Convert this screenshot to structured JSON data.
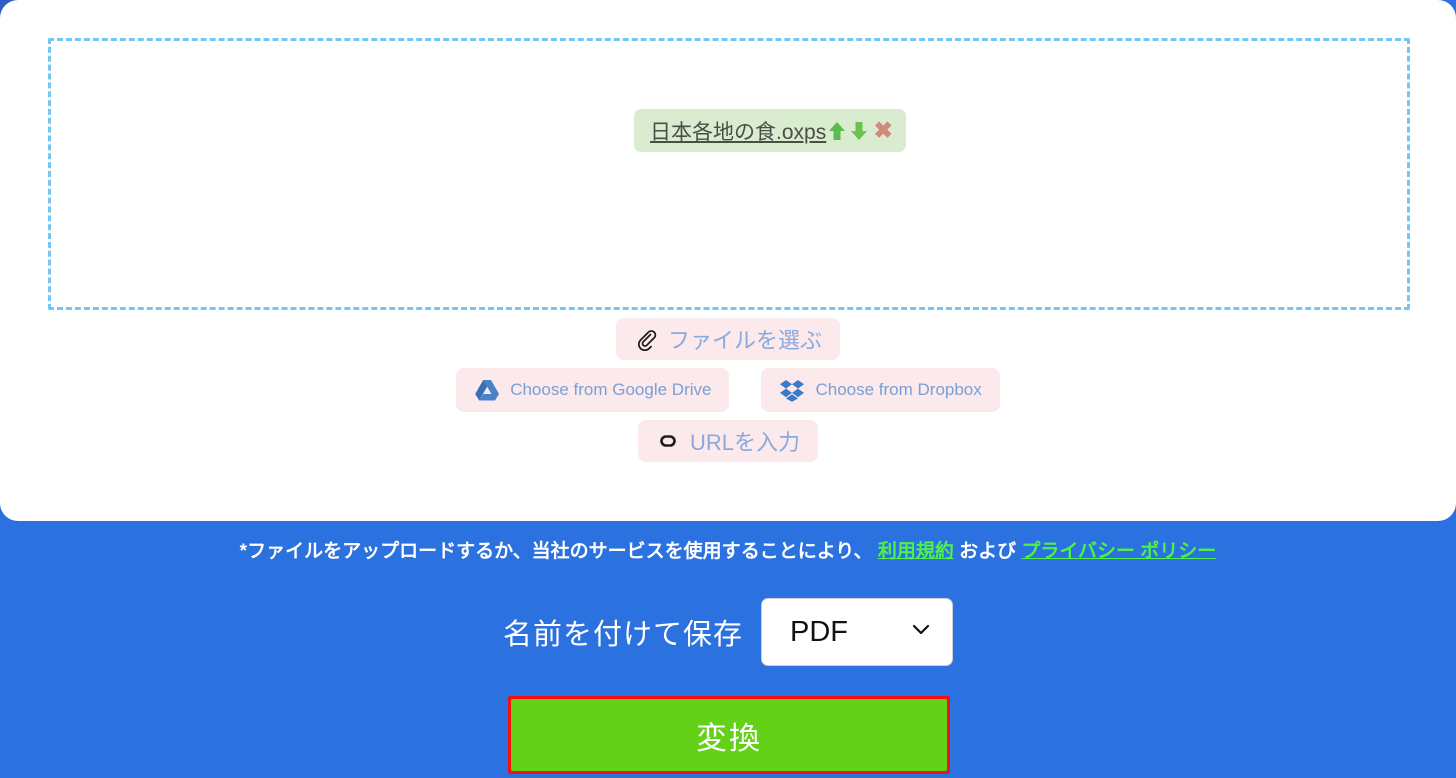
{
  "theme": {
    "background_blue": "#2b71e0",
    "card_white": "#ffffff",
    "dropzone_border": "#73c7f2",
    "chip_bg": "#d9ecd0",
    "source_btn_bg": "#fbe9ec",
    "source_btn_text": "#7a9fd4",
    "link_green": "#4ef14a",
    "convert_green": "#63d118",
    "highlight_red": "#f50f0f"
  },
  "dropzone": {
    "name": "file-drop-zone",
    "file_chip": {
      "filename": "日本各地の食.oxps",
      "move_up_icon": "arrow-up-icon",
      "move_down_icon": "arrow-down-icon",
      "remove_icon": "close-x-icon",
      "remove_glyph": "✖"
    }
  },
  "sources": {
    "choose_file": {
      "label": "ファイルを選ぶ",
      "icon": "paperclip-icon"
    },
    "google_drive": {
      "label": "Choose from Google Drive",
      "icon": "google-drive-icon"
    },
    "dropbox": {
      "label": "Choose from Dropbox",
      "icon": "dropbox-icon"
    },
    "enter_url": {
      "label": "URLを入力",
      "icon": "link-chain-icon"
    }
  },
  "disclaimer": {
    "prefix": "*ファイルをアップロードするか、当社のサービスを使用することにより、 ",
    "terms_link": "利用規約",
    "middle": " および ",
    "privacy_link": "プライバシー ポリシー"
  },
  "save_as": {
    "label": "名前を付けて保存",
    "selected_format": "PDF",
    "options": [
      "PDF"
    ],
    "chevron_icon": "chevron-down-icon"
  },
  "convert": {
    "label": "変換"
  }
}
